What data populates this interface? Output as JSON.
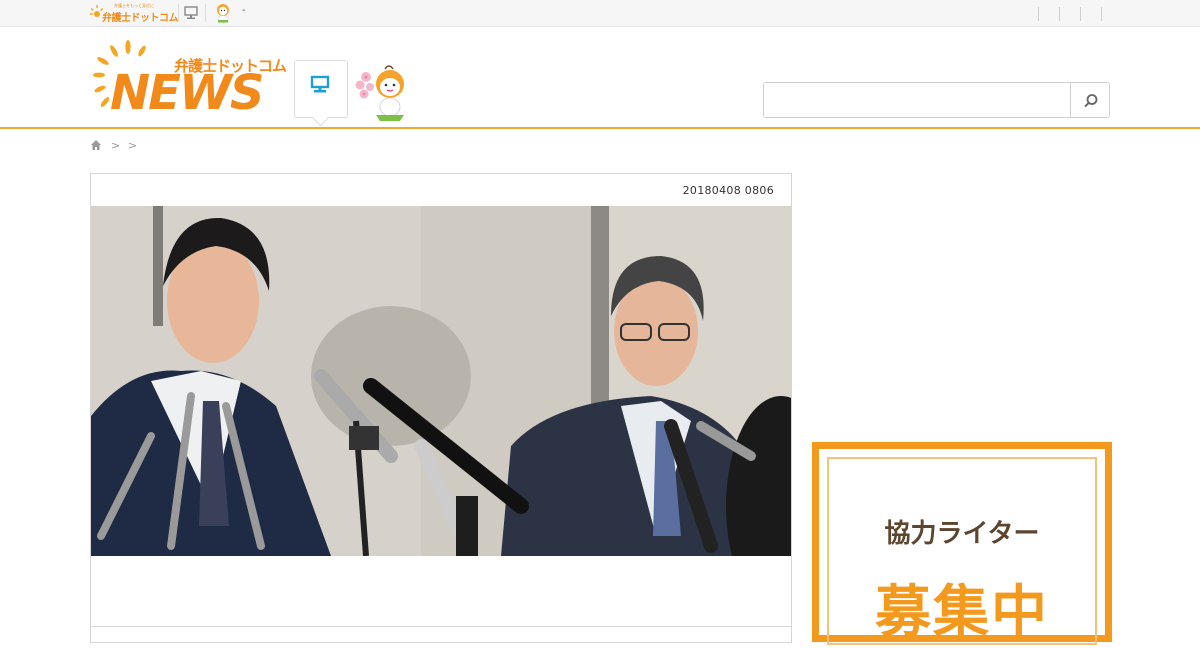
{
  "topbar": {
    "mini_logo_text": "弁護士ドットコム",
    "mini_logo_tagline": "弁護士をもっと身近に",
    "mini_logo_icon": "sun-logo-icon",
    "pc_icon": "computer-icon",
    "character_icon": "mascot-icon",
    "character_text": "-"
  },
  "header": {
    "logo_word": "NEWS",
    "logo_brand": "弁護士ドットコム",
    "category_icon": "computer-icon",
    "mascot": "bengoshi-mascot-character",
    "search": {
      "value": "",
      "placeholder": "",
      "button_icon": "search-icon"
    }
  },
  "breadcrumb": {
    "home_icon": "home-icon",
    "separators": [
      ">",
      ">"
    ]
  },
  "article": {
    "date": "20180408 0806",
    "image": "press-conference-photo"
  },
  "ad": {
    "line1": "協力ライター",
    "line2": "募集中"
  },
  "colors": {
    "brand_orange": "#f28a1b",
    "header_rule": "#f2a92e",
    "pc_icon_blue": "#1ea0d2",
    "ad_border": "#f39a1e",
    "ad_text_brown": "#5d4630"
  }
}
